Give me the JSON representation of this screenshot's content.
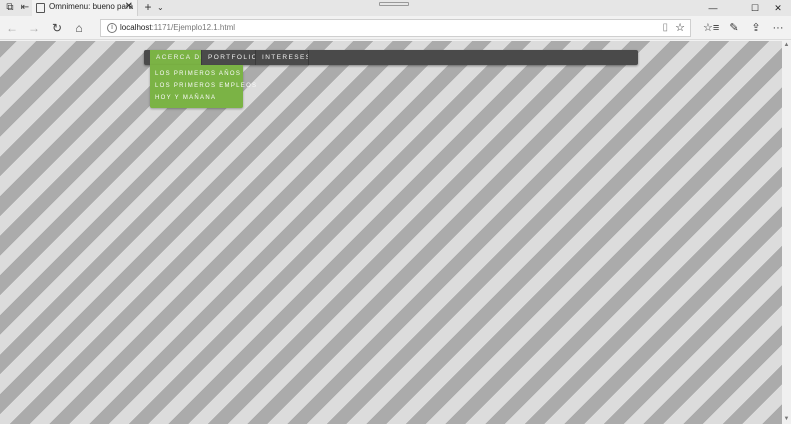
{
  "browser": {
    "tab": {
      "title": "Omnimenu: bueno para",
      "close": "✕"
    },
    "new_tab": "+",
    "tab_dropdown": "⌄",
    "window": {
      "minimize": "—",
      "maximize": "☐",
      "close": "✕"
    },
    "nav": {
      "back": "←",
      "forward": "→",
      "refresh": "↻",
      "home": "⌂"
    },
    "address": {
      "host": "localhost",
      "path": ":1171/Ejemplo12.1.html"
    },
    "tools": {
      "hub": "☆≡",
      "notes": "✎",
      "share": "⇪",
      "more": "···"
    }
  },
  "menu": {
    "items": [
      {
        "label": "ACERCA DE MI"
      },
      {
        "label": "PORTFOLIO"
      },
      {
        "label": "INTERESES"
      }
    ],
    "submenu": [
      {
        "label": "LOS PRIMEROS AÑOS"
      },
      {
        "label": "LOS PRIMEROS EMPLEOS"
      },
      {
        "label": "HOY Y MAÑANA"
      }
    ]
  },
  "colors": {
    "menu_bg": "#4a4a4a",
    "menu_active": "#7bb345",
    "stripe_dark": "#ababab",
    "stripe_light": "#dcdcdc"
  }
}
